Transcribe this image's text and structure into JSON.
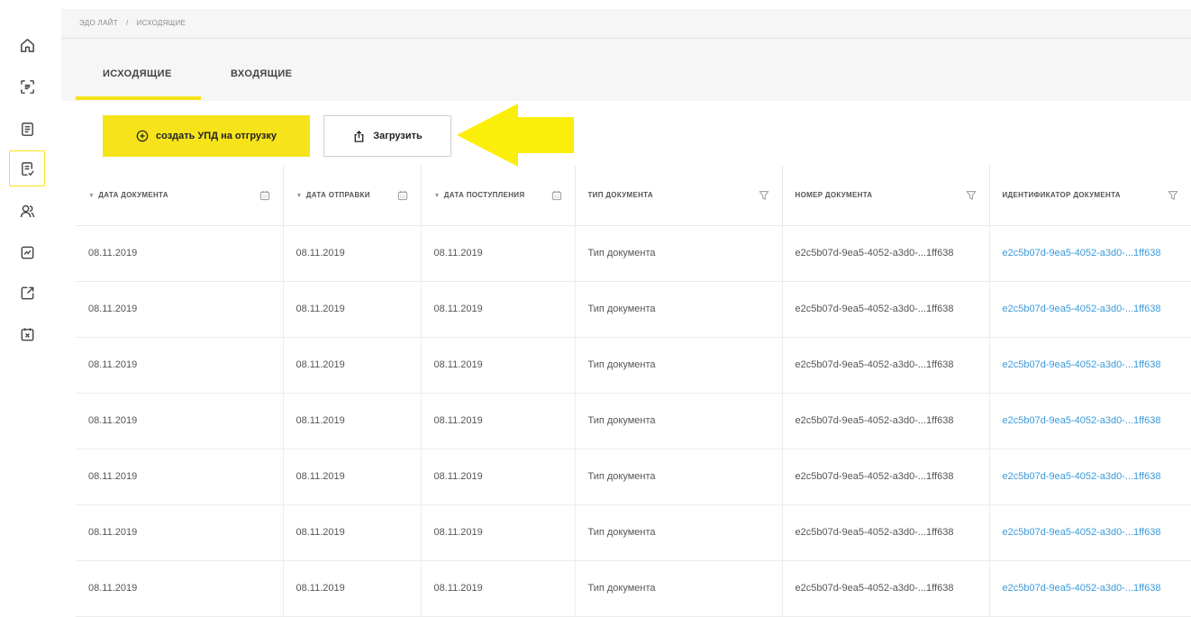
{
  "breadcrumb": {
    "root": "ЭДО ЛАЙТ",
    "separator": "/",
    "current": "ИСХОДЯЩИЕ"
  },
  "tabs": [
    {
      "label": "ИСХОДЯЩИЕ",
      "active": true
    },
    {
      "label": "ВХОДЯЩИЕ",
      "active": false
    }
  ],
  "toolbar": {
    "create_label": "создать УПД на отгрузку",
    "upload_label": "Загрузить"
  },
  "sidebar": {
    "items": [
      {
        "icon": "home-icon"
      },
      {
        "icon": "scan-icon"
      },
      {
        "icon": "document-icon"
      },
      {
        "icon": "document-check-icon",
        "active": true
      },
      {
        "icon": "users-icon"
      },
      {
        "icon": "chart-icon"
      },
      {
        "icon": "external-link-icon"
      },
      {
        "icon": "calendar-x-icon"
      }
    ]
  },
  "table": {
    "columns": [
      {
        "label": "ДАТА ДОКУМЕНТА",
        "sortable": true,
        "icon": "calendar-icon"
      },
      {
        "label": "ДАТА ОТПРАВКИ",
        "sortable": true,
        "icon": "calendar-icon"
      },
      {
        "label": "ДАТА ПОСТУПЛЕНИЯ",
        "sortable": true,
        "icon": "calendar-icon"
      },
      {
        "label": "ТИП ДОКУМЕНТА",
        "sortable": false,
        "icon": "filter-icon"
      },
      {
        "label": "НОМЕР ДОКУМЕНТА",
        "sortable": false,
        "icon": "filter-icon"
      },
      {
        "label": "ИДЕНТИФИКАТОР ДОКУМЕНТА",
        "sortable": false,
        "icon": "filter-icon"
      }
    ],
    "rows": [
      [
        "08.11.2019",
        "08.11.2019",
        "08.11.2019",
        "Тип документа",
        "e2c5b07d-9ea5-4052-a3d0-...1ff638",
        "e2c5b07d-9ea5-4052-a3d0-...1ff638"
      ],
      [
        "08.11.2019",
        "08.11.2019",
        "08.11.2019",
        "Тип документа",
        "e2c5b07d-9ea5-4052-a3d0-...1ff638",
        "e2c5b07d-9ea5-4052-a3d0-...1ff638"
      ],
      [
        "08.11.2019",
        "08.11.2019",
        "08.11.2019",
        "Тип документа",
        "e2c5b07d-9ea5-4052-a3d0-...1ff638",
        "e2c5b07d-9ea5-4052-a3d0-...1ff638"
      ],
      [
        "08.11.2019",
        "08.11.2019",
        "08.11.2019",
        "Тип документа",
        "e2c5b07d-9ea5-4052-a3d0-...1ff638",
        "e2c5b07d-9ea5-4052-a3d0-...1ff638"
      ],
      [
        "08.11.2019",
        "08.11.2019",
        "08.11.2019",
        "Тип документа",
        "e2c5b07d-9ea5-4052-a3d0-...1ff638",
        "e2c5b07d-9ea5-4052-a3d0-...1ff638"
      ],
      [
        "08.11.2019",
        "08.11.2019",
        "08.11.2019",
        "Тип документа",
        "e2c5b07d-9ea5-4052-a3d0-...1ff638",
        "e2c5b07d-9ea5-4052-a3d0-...1ff638"
      ],
      [
        "08.11.2019",
        "08.11.2019",
        "08.11.2019",
        "Тип документа",
        "e2c5b07d-9ea5-4052-a3d0-...1ff638",
        "e2c5b07d-9ea5-4052-a3d0-...1ff638"
      ]
    ]
  },
  "colors": {
    "accent": "#f7e31a",
    "link": "#3a9ad9",
    "header_bg": "#f6f6f6"
  },
  "annotation": {
    "icon": "yellow-arrow-icon"
  }
}
